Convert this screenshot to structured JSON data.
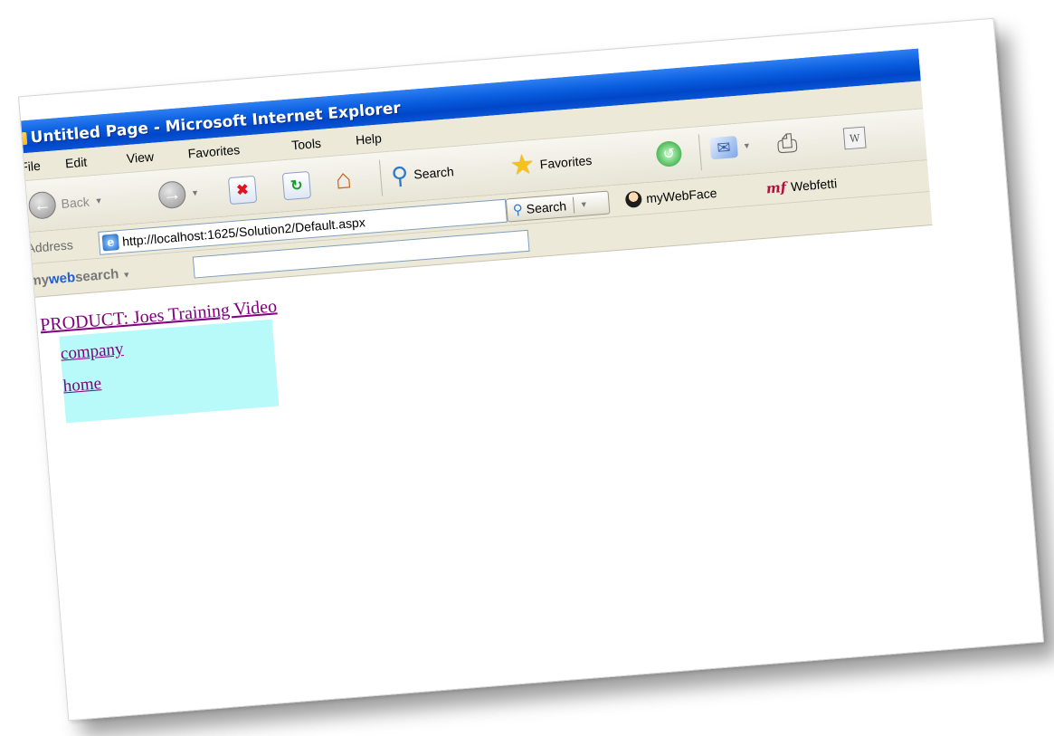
{
  "window": {
    "title": "Untitled Page - Microsoft Internet Explorer"
  },
  "menubar": {
    "items": [
      "File",
      "Edit",
      "View",
      "Favorites",
      "Tools",
      "Help"
    ]
  },
  "toolbar": {
    "back_label": "Back",
    "search_label": "Search",
    "favorites_label": "Favorites"
  },
  "addressbar": {
    "label": "Address",
    "url": "http://localhost:1625/Solution2/Default.aspx",
    "search_button_label": "Search",
    "links": [
      "myWebFace",
      "Webfetti"
    ]
  },
  "websearch": {
    "logo_prefix": "my",
    "logo_web": "web",
    "logo_suffix": "search",
    "input_value": ""
  },
  "page": {
    "product_link": "PRODUCT: Joes Training Video",
    "submenu": [
      "company",
      "home"
    ]
  },
  "colors": {
    "titlebar": "#0a5fe0",
    "chrome": "#ece9d8",
    "visited_link": "#800080",
    "submenu_bg": "#b8fafa"
  }
}
